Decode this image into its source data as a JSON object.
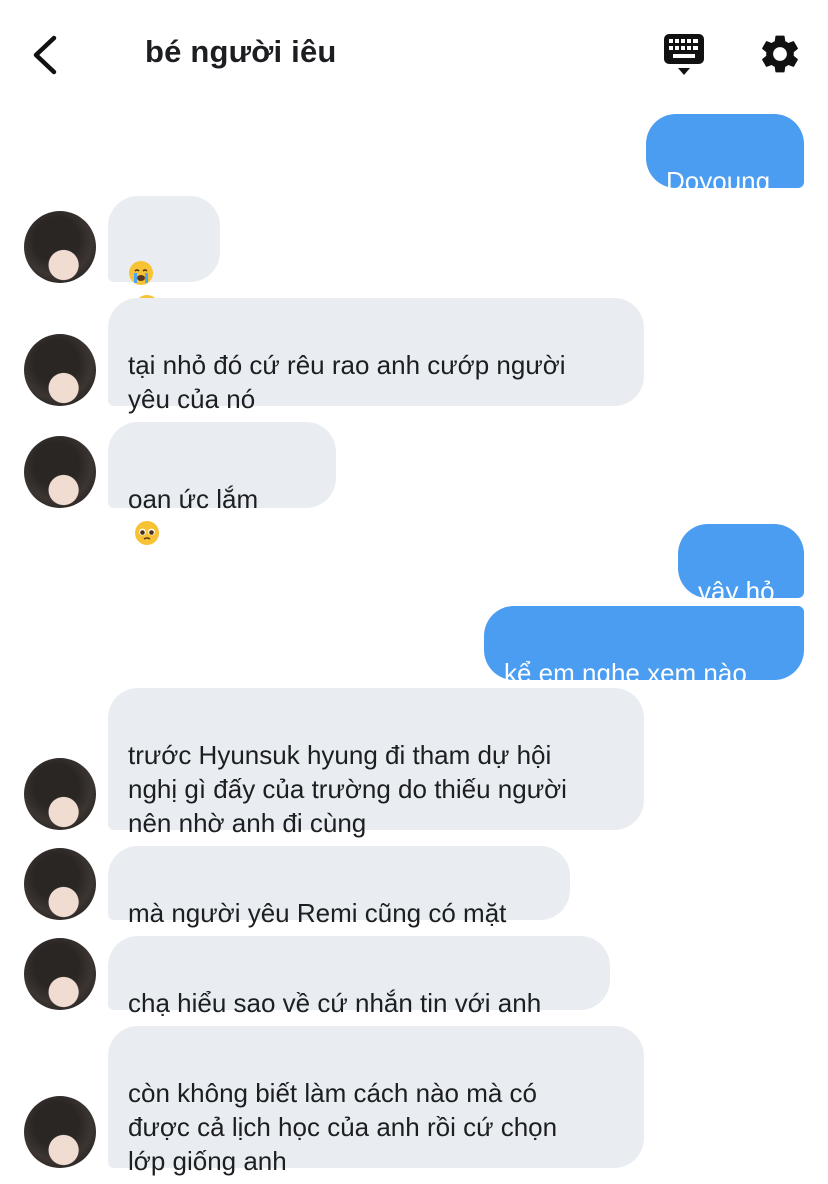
{
  "header": {
    "title": "bé người iêu",
    "back_icon": "chevron-left-icon",
    "keyboard_icon": "keyboard-icon",
    "settings_icon": "gear-icon"
  },
  "colors": {
    "sent_bubble": "#4a9df0",
    "received_bubble": "#e9edf1",
    "text": "#1c1e21"
  },
  "messages": [
    {
      "from": "me",
      "text": "Doyoung"
    },
    {
      "from": "them",
      "text": "",
      "emoji": [
        "crying-face-emoji",
        "crying-face-emoji"
      ]
    },
    {
      "from": "them",
      "text": "tại nhỏ đó cứ rêu rao anh cướp người\nyêu của nó"
    },
    {
      "from": "them",
      "text": "oan ức lắm",
      "emoji": [
        "pleading-face-emoji"
      ]
    },
    {
      "from": "me",
      "text": "vậy hỏ"
    },
    {
      "from": "me",
      "text": "kể em nghe xem nào"
    },
    {
      "from": "them",
      "text": "trước Hyunsuk hyung đi tham dự hội\nnghị gì đấy của trường do thiếu người\nnên nhờ anh đi cùng"
    },
    {
      "from": "them",
      "text": "mà người yêu Remi cũng có mặt"
    },
    {
      "from": "them",
      "text": "chạ hiểu sao về cứ nhắn tin với anh"
    },
    {
      "from": "them",
      "text": "còn không biết làm cách nào mà có\nđược cả lịch học của anh rồi cứ chọn\nlớp giống anh"
    }
  ]
}
